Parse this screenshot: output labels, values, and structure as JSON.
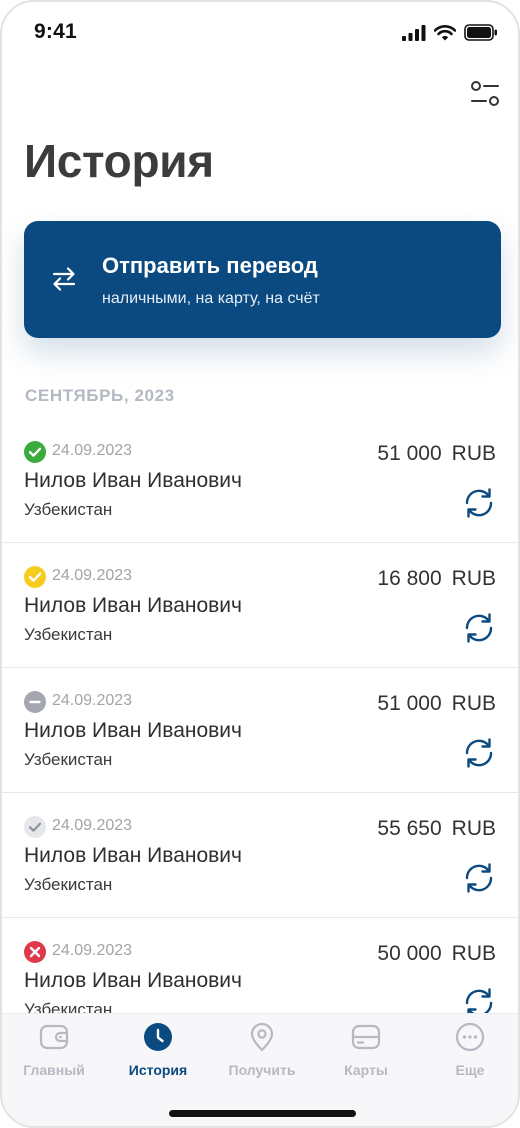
{
  "status_bar": {
    "time": "9:41"
  },
  "header": {
    "title": "История",
    "filter_icon": "filter-sliders-icon"
  },
  "transfer_card": {
    "title": "Отправить перевод",
    "subtitle": "наличными, на карту, на счёт",
    "icon": "swap-arrows-icon",
    "background": "#0b4a80"
  },
  "section": {
    "label": "СЕНТЯБРЬ, 2023"
  },
  "transactions": [
    {
      "status": "success",
      "status_color": "#3caa3c",
      "date": "24.09.2023",
      "name": "Нилов Иван Иванович",
      "country": "Узбекистан",
      "amount": "51 000",
      "currency": "RUB"
    },
    {
      "status": "pending",
      "status_color": "#f5cc1f",
      "date": "24.09.2023",
      "name": "Нилов Иван Иванович",
      "country": "Узбекистан",
      "amount": "16 800",
      "currency": "RUB"
    },
    {
      "status": "cancelled",
      "status_color": "#a4a7b0",
      "date": "24.09.2023",
      "name": "Нилов Иван Иванович",
      "country": "Узбекистан",
      "amount": "51 000",
      "currency": "RUB"
    },
    {
      "status": "completed",
      "status_color": "#e6e7ea",
      "date": "24.09.2023",
      "name": "Нилов Иван Иванович",
      "country": "Узбекистан",
      "amount": "55 650",
      "currency": "RUB"
    },
    {
      "status": "error",
      "status_color": "#e03a4a",
      "date": "24.09.2023",
      "name": "Нилов Иван Иванович",
      "country": "Узбекистан",
      "amount": "50 000",
      "currency": "RUB"
    }
  ],
  "tab_bar": {
    "active": "history",
    "items": [
      {
        "id": "home",
        "label": "Главный",
        "icon": "wallet-icon"
      },
      {
        "id": "history",
        "label": "История",
        "icon": "clock-icon"
      },
      {
        "id": "receive",
        "label": "Получить",
        "icon": "location-pin-icon"
      },
      {
        "id": "cards",
        "label": "Карты",
        "icon": "card-icon"
      },
      {
        "id": "more",
        "label": "Еще",
        "icon": "more-dots-icon"
      }
    ]
  },
  "colors": {
    "accent": "#0b4a80",
    "muted": "#b6b9c2"
  }
}
